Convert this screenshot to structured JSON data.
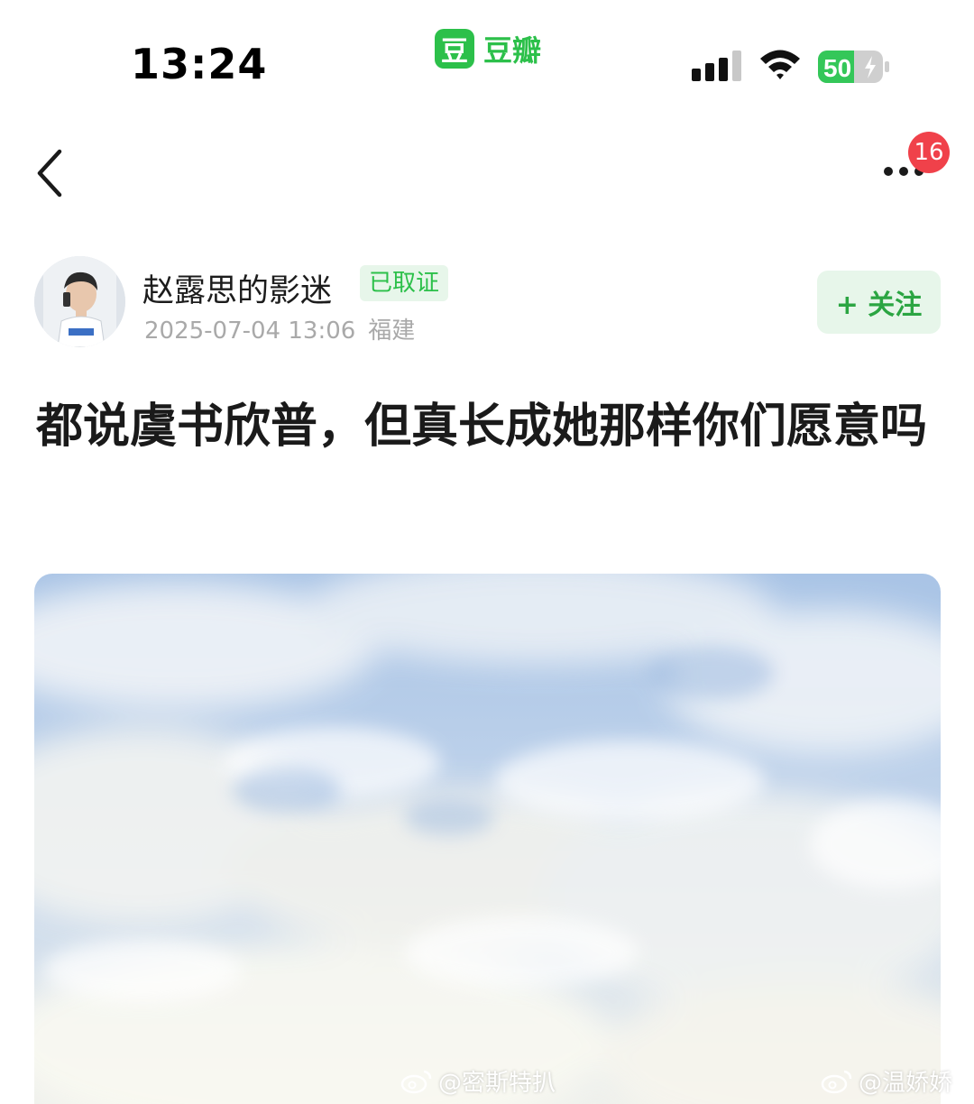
{
  "status_bar": {
    "time": "13:24",
    "app_logo_char": "豆",
    "app_name": "豆瓣",
    "battery_level": "50"
  },
  "nav": {
    "back_icon": "chevron-left-icon",
    "more_icon": "ellipsis-icon",
    "notification_count": "16"
  },
  "author": {
    "name": "赵露思的影迷",
    "verified_label": "已取证",
    "date": "2025-07-04 13:06",
    "location": "福建",
    "follow_label": "+ 关注"
  },
  "post": {
    "title": "都说虞书欣普，但真长成她那样你们愿意吗"
  },
  "watermarks": [
    {
      "text": "@密斯特扒"
    },
    {
      "text": "@温娇娇"
    }
  ],
  "colors": {
    "brand_green": "#2cc04a",
    "badge_red": "#f0414a",
    "follow_bg": "#e7f6ea"
  }
}
